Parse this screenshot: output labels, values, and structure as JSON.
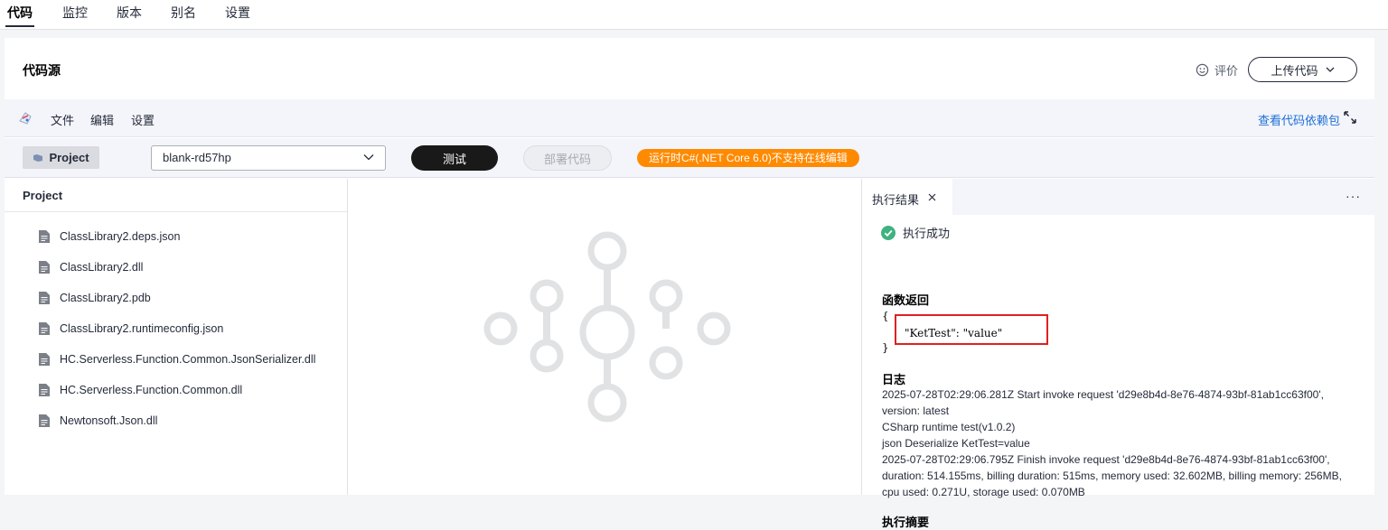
{
  "top_tabs": [
    "代码",
    "监控",
    "版本",
    "别名",
    "设置"
  ],
  "card": {
    "title": "代码源",
    "rate_label": "评价",
    "upload_label": "上传代码"
  },
  "menu": {
    "items": [
      "文件",
      "编辑",
      "设置"
    ],
    "dependency_link": "查看代码依赖包"
  },
  "toolbar": {
    "project_label": "Project",
    "function_select": "blank-rd57hp",
    "test_label": "测试",
    "deploy_label": "部署代码",
    "warning": "运行时C#(.NET Core 6.0)不支持在线编辑"
  },
  "explorer": {
    "title": "Project",
    "files": [
      "ClassLibrary2.deps.json",
      "ClassLibrary2.dll",
      "ClassLibrary2.pdb",
      "ClassLibrary2.runtimeconfig.json",
      "HC.Serverless.Function.Common.JsonSerializer.dll",
      "HC.Serverless.Function.Common.dll",
      "Newtonsoft.Json.dll"
    ]
  },
  "result": {
    "tab_label": "执行结果",
    "status": "执行成功",
    "return_title": "函数返回",
    "json_open": "{",
    "json_body": "\"KetTest\": \"value\"",
    "json_close": "}",
    "log_title": "日志",
    "log_lines": [
      "2025-07-28T02:29:06.281Z Start invoke request 'd29e8b4d-8e76-4874-93bf-81ab1cc63f00',",
      "version: latest",
      "CSharp runtime test(v1.0.2)",
      "json Deserialize KetTest=value",
      "2025-07-28T02:29:06.795Z Finish invoke request 'd29e8b4d-8e76-4874-93bf-81ab1cc63f00',",
      "duration: 514.155ms, billing duration: 515ms, memory used: 32.602MB, billing memory: 256MB,",
      "cpu used: 0.271U, storage used: 0.070MB"
    ],
    "summary_title": "执行摘要"
  },
  "colors": {
    "accent_link": "#1f6fd6",
    "warning_badge": "#ff8a00",
    "success_green": "#3fb27f",
    "highlight_box": "#e02020"
  }
}
